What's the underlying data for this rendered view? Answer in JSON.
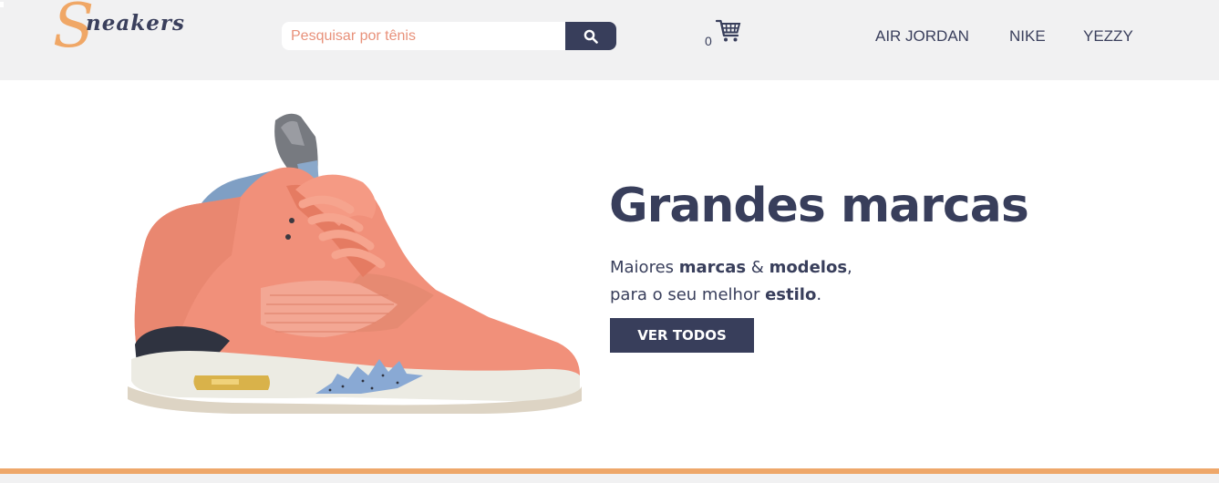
{
  "header": {
    "logo": {
      "initial": "S",
      "rest": "neakers"
    },
    "search": {
      "placeholder": "Pesquisar por tênis",
      "value": "",
      "button_icon": "search-icon"
    },
    "cart": {
      "count": "0",
      "icon": "cart-icon"
    },
    "nav": [
      {
        "label": "AIR JORDAN"
      },
      {
        "label": "NIKE"
      },
      {
        "label": "YEZZY"
      }
    ]
  },
  "hero": {
    "title": "Grandes marcas",
    "subtitle": {
      "w1": "Maiores ",
      "b1": "marcas",
      "w2": " & ",
      "b2": "modelos",
      "w3": ",",
      "w4": "para o seu melhor ",
      "b3": "estilo",
      "w5": "."
    },
    "cta_label": "VER TODOS"
  },
  "colors": {
    "header_bg": "#f1f1f2",
    "navy": "#383e5b",
    "accent_orange": "#eea76a",
    "placeholder_salmon": "#e8917a"
  }
}
